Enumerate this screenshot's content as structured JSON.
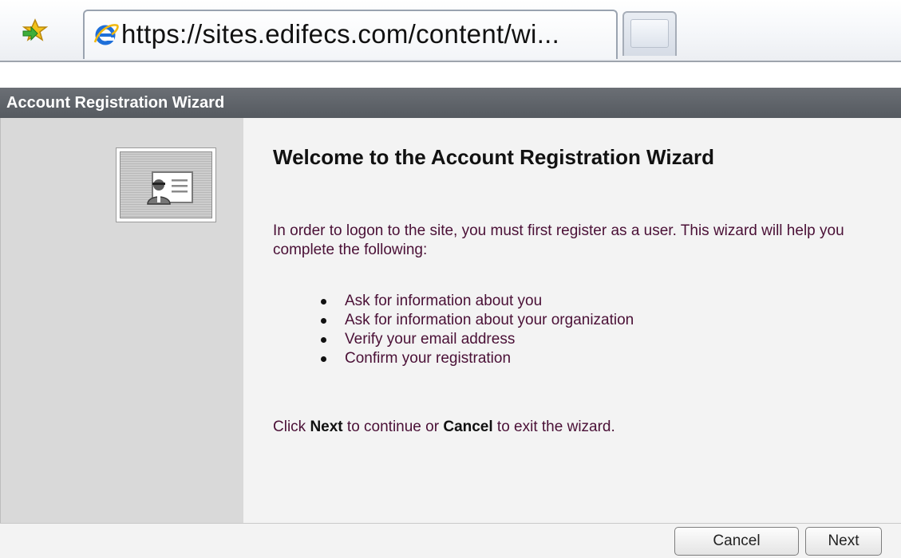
{
  "browser": {
    "tab_title": "https://sites.edifecs.com/content/wi...",
    "favorites_icon": "favorites-star-icon",
    "tab_icon": "internet-explorer-icon"
  },
  "wizard": {
    "header_title": "Account Registration Wizard",
    "avatar_icon": "user-card-icon",
    "welcome_title": "Welcome to the Account Registration Wizard",
    "intro_text": "In order to logon to the site, you must first register as a user. This wizard will help you complete the following:",
    "steps": [
      "Ask for information about you",
      "Ask for information about your organization",
      "Verify your email address",
      "Confirm your registration"
    ],
    "hint": {
      "part1": "Click ",
      "next_word": "Next",
      "part2": " to continue or ",
      "cancel_word": "Cancel",
      "part3": " to exit the wizard."
    },
    "buttons": {
      "cancel_label": "Cancel",
      "next_label": "Next"
    }
  },
  "colors": {
    "header_bg": "#5f6369",
    "left_pane_bg": "#d9d9d9",
    "body_bg": "#f3f3f3",
    "body_text": "#4a1036"
  }
}
